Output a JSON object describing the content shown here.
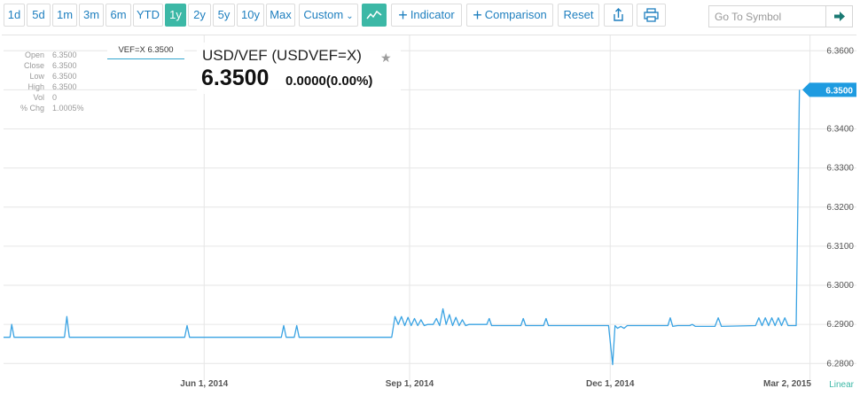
{
  "toolbar": {
    "ranges": [
      "1d",
      "5d",
      "1m",
      "3m",
      "6m",
      "YTD",
      "1y",
      "2y",
      "5y",
      "10y",
      "Max"
    ],
    "active_range": "1y",
    "custom_label": "Custom",
    "indicator_label": "Indicator",
    "comparison_label": "Comparison",
    "reset_label": "Reset",
    "search_placeholder": "Go To Symbol"
  },
  "quote": {
    "ticker_tag": "VEF=X 6.3500",
    "symbol_title": "USD/VEF (USDVEF=X)",
    "price": "6.3500",
    "change": "0.0000(0.00%)",
    "ohlc": [
      {
        "label": "Open",
        "value": "6.3500"
      },
      {
        "label": "Close",
        "value": "6.3500"
      },
      {
        "label": "Low",
        "value": "6.3500"
      },
      {
        "label": "High",
        "value": "6.3500"
      },
      {
        "label": "Vol",
        "value": "0"
      },
      {
        "label": "% Chg",
        "value": "1.0005%"
      }
    ]
  },
  "colors": {
    "line": "#3aa3e3",
    "accent": "#3cb8a6",
    "link": "#1e7fbf",
    "grid": "#e6e6e6"
  },
  "chart_data": {
    "type": "line",
    "y_ticks": [
      "6.3600",
      "6.3500",
      "6.3400",
      "6.3300",
      "6.3200",
      "6.3100",
      "6.3000",
      "6.2900",
      "6.2800"
    ],
    "ylim": [
      6.2778,
      6.3612
    ],
    "x_ticks": [
      "Jun 1, 2014",
      "Sep 1, 2014",
      "Dec 1, 2014",
      "Mar 2, 2015"
    ],
    "x_tick_positions": [
      0.247,
      0.5,
      0.747,
      0.993
    ],
    "scale_label": "Linear",
    "last_value_label": "6.3500",
    "grid": true,
    "series": [
      {
        "points": [
          [
            0.0,
            6.2867
          ],
          [
            0.008,
            6.2867
          ],
          [
            0.01,
            6.29
          ],
          [
            0.013,
            6.2867
          ],
          [
            0.075,
            6.2867
          ],
          [
            0.078,
            6.292
          ],
          [
            0.081,
            6.2867
          ],
          [
            0.223,
            6.2867
          ],
          [
            0.226,
            6.2897
          ],
          [
            0.229,
            6.2867
          ],
          [
            0.342,
            6.2867
          ],
          [
            0.345,
            6.2897
          ],
          [
            0.348,
            6.2867
          ],
          [
            0.358,
            6.2867
          ],
          [
            0.361,
            6.2897
          ],
          [
            0.364,
            6.2867
          ],
          [
            0.478,
            6.2867
          ],
          [
            0.482,
            6.292
          ],
          [
            0.486,
            6.29
          ],
          [
            0.49,
            6.292
          ],
          [
            0.494,
            6.2897
          ],
          [
            0.498,
            6.2918
          ],
          [
            0.502,
            6.2897
          ],
          [
            0.506,
            6.2915
          ],
          [
            0.51,
            6.2897
          ],
          [
            0.514,
            6.2912
          ],
          [
            0.518,
            6.2897
          ],
          [
            0.522,
            6.29
          ],
          [
            0.529,
            6.29
          ],
          [
            0.533,
            6.2915
          ],
          [
            0.537,
            6.2897
          ],
          [
            0.541,
            6.294
          ],
          [
            0.545,
            6.29
          ],
          [
            0.549,
            6.2925
          ],
          [
            0.553,
            6.2897
          ],
          [
            0.557,
            6.2918
          ],
          [
            0.561,
            6.2897
          ],
          [
            0.565,
            6.2912
          ],
          [
            0.569,
            6.2897
          ],
          [
            0.573,
            6.29
          ],
          [
            0.595,
            6.29
          ],
          [
            0.598,
            6.2915
          ],
          [
            0.601,
            6.2897
          ],
          [
            0.637,
            6.2897
          ],
          [
            0.64,
            6.2915
          ],
          [
            0.643,
            6.2897
          ],
          [
            0.665,
            6.2897
          ],
          [
            0.668,
            6.2915
          ],
          [
            0.671,
            6.2897
          ],
          [
            0.745,
            6.2897
          ],
          [
            0.75,
            6.2797
          ],
          [
            0.753,
            6.2897
          ],
          [
            0.756,
            6.289
          ],
          [
            0.76,
            6.2895
          ],
          [
            0.764,
            6.289
          ],
          [
            0.768,
            6.2897
          ],
          [
            0.818,
            6.2897
          ],
          [
            0.821,
            6.2917
          ],
          [
            0.824,
            6.2895
          ],
          [
            0.83,
            6.2897
          ],
          [
            0.845,
            6.2897
          ],
          [
            0.848,
            6.29
          ],
          [
            0.852,
            6.2895
          ],
          [
            0.876,
            6.2895
          ],
          [
            0.88,
            6.2917
          ],
          [
            0.884,
            6.2895
          ],
          [
            0.926,
            6.2897
          ],
          [
            0.93,
            6.2917
          ],
          [
            0.934,
            6.2897
          ],
          [
            0.938,
            6.2917
          ],
          [
            0.942,
            6.2897
          ],
          [
            0.946,
            6.2917
          ],
          [
            0.95,
            6.2897
          ],
          [
            0.954,
            6.2917
          ],
          [
            0.958,
            6.2897
          ],
          [
            0.962,
            6.2917
          ],
          [
            0.966,
            6.2897
          ],
          [
            0.975,
            6.2897
          ],
          [
            0.976,
            6.2897
          ],
          [
            0.98,
            6.35
          ]
        ]
      }
    ]
  }
}
